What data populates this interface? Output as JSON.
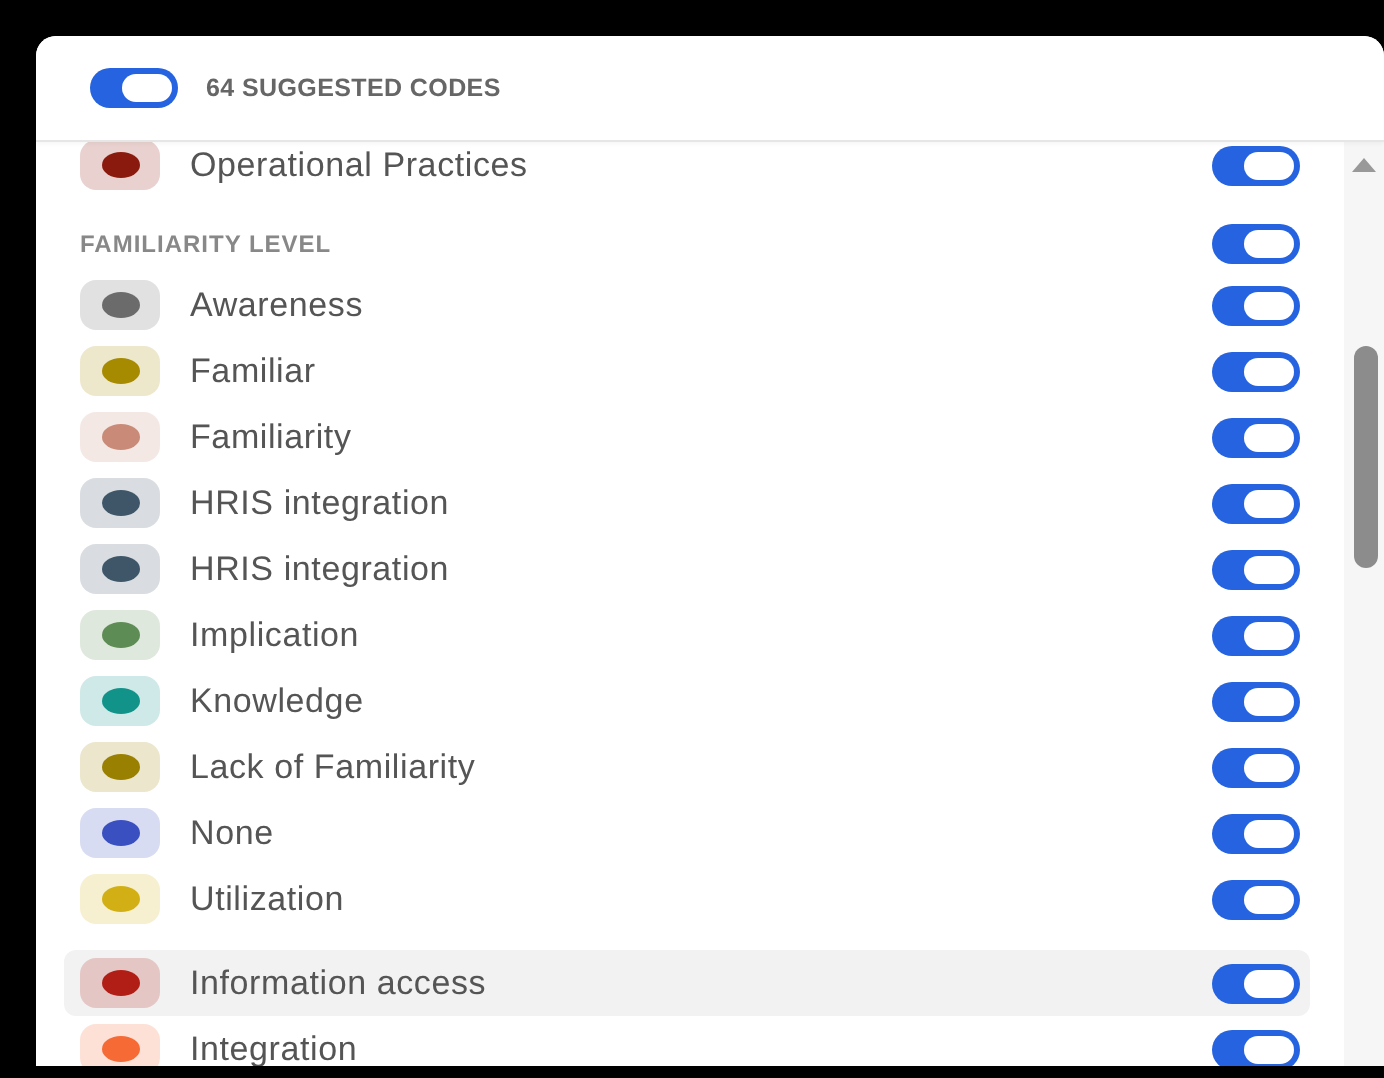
{
  "header": {
    "label": "64 SUGGESTED CODES",
    "on": true
  },
  "groups": [
    {
      "items": [
        {
          "label": "Operational Practices",
          "color": "#8b1a0e",
          "on": true,
          "selected": false
        }
      ]
    },
    {
      "heading": "FAMILIARITY LEVEL",
      "on": true,
      "items": [
        {
          "label": "Awareness",
          "color": "#6b6b6b",
          "on": true,
          "selected": false
        },
        {
          "label": "Familiar",
          "color": "#a68a00",
          "on": true,
          "selected": false
        },
        {
          "label": "Familiarity",
          "color": "#c98a78",
          "on": true,
          "selected": false
        },
        {
          "label": "HRIS integration",
          "color": "#3f5668",
          "on": true,
          "selected": false
        },
        {
          "label": "HRIS integration",
          "color": "#3f5668",
          "on": true,
          "selected": false
        },
        {
          "label": "Implication",
          "color": "#5e8c55",
          "on": true,
          "selected": false
        },
        {
          "label": "Knowledge",
          "color": "#11938a",
          "on": true,
          "selected": false
        },
        {
          "label": "Lack of Familiarity",
          "color": "#9a8000",
          "on": true,
          "selected": false
        },
        {
          "label": "None",
          "color": "#3a4fc0",
          "on": true,
          "selected": false
        },
        {
          "label": "Utilization",
          "color": "#d2b015",
          "on": true,
          "selected": false
        }
      ]
    },
    {
      "items": [
        {
          "label": "Information access",
          "color": "#b01e16",
          "on": true,
          "selected": true
        },
        {
          "label": "Integration",
          "color": "#f56a35",
          "on": true,
          "selected": false
        }
      ]
    }
  ]
}
